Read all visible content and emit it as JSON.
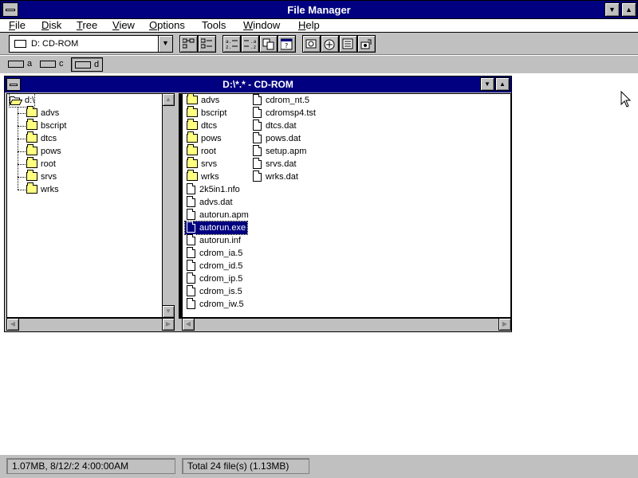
{
  "window": {
    "title": "File Manager"
  },
  "menu": [
    {
      "label": "File",
      "accel": "F",
      "rest": "ile"
    },
    {
      "label": "Disk",
      "accel": "D",
      "rest": "isk"
    },
    {
      "label": "Tree",
      "accel": "T",
      "rest": "ree"
    },
    {
      "label": "View",
      "accel": "V",
      "rest": "iew"
    },
    {
      "label": "Options",
      "accel": "O",
      "rest": "ptions"
    },
    {
      "label": "Tools",
      "accel": "",
      "rest": "Tools"
    },
    {
      "label": "Window",
      "accel": "W",
      "rest": "indow"
    },
    {
      "label": "Help",
      "accel": "H",
      "rest": "elp"
    }
  ],
  "toolbar": {
    "drive_selected": "D: CD-ROM"
  },
  "drives": [
    {
      "letter": "a",
      "icon": "floppy-drive-icon"
    },
    {
      "letter": "c",
      "icon": "hard-drive-icon"
    },
    {
      "letter": "d",
      "icon": "cdrom-drive-icon",
      "selected": true
    }
  ],
  "child": {
    "title": "D:\\*.* - CD-ROM",
    "tree": {
      "root": "d:\\",
      "folders": [
        "advs",
        "bscript",
        "dtcs",
        "pows",
        "root",
        "srvs",
        "wrks"
      ]
    },
    "files": [
      {
        "name": "advs",
        "type": "folder"
      },
      {
        "name": "bscript",
        "type": "folder"
      },
      {
        "name": "dtcs",
        "type": "folder"
      },
      {
        "name": "pows",
        "type": "folder"
      },
      {
        "name": "root",
        "type": "folder"
      },
      {
        "name": "srvs",
        "type": "folder"
      },
      {
        "name": "wrks",
        "type": "folder"
      },
      {
        "name": "2k5in1.nfo",
        "type": "file"
      },
      {
        "name": "advs.dat",
        "type": "file"
      },
      {
        "name": "autorun.apm",
        "type": "file"
      },
      {
        "name": "autorun.exe",
        "type": "exe",
        "selected": true
      },
      {
        "name": "autorun.inf",
        "type": "file"
      },
      {
        "name": "cdrom_ia.5",
        "type": "file"
      },
      {
        "name": "cdrom_id.5",
        "type": "file"
      },
      {
        "name": "cdrom_ip.5",
        "type": "file"
      },
      {
        "name": "cdrom_is.5",
        "type": "file"
      },
      {
        "name": "cdrom_iw.5",
        "type": "file"
      },
      {
        "name": "cdrom_nt.5",
        "type": "file"
      },
      {
        "name": "cdromsp4.tst",
        "type": "file"
      },
      {
        "name": "dtcs.dat",
        "type": "file"
      },
      {
        "name": "pows.dat",
        "type": "file"
      },
      {
        "name": "setup.apm",
        "type": "file"
      },
      {
        "name": "srvs.dat",
        "type": "file"
      },
      {
        "name": "wrks.dat",
        "type": "file"
      }
    ]
  },
  "status": {
    "left": "1.07MB, 8/12/:2 4:00:00AM",
    "right": "Total 24 file(s) (1.13MB)"
  }
}
